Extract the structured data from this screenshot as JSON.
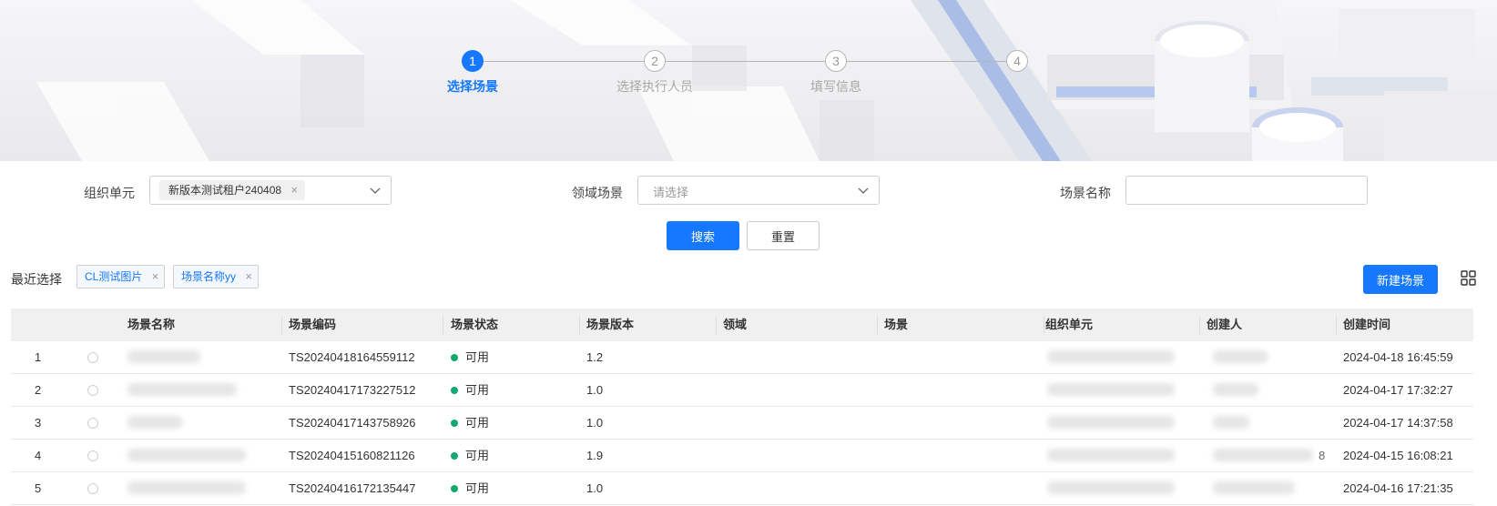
{
  "steps": [
    {
      "num": "1",
      "label": "选择场景",
      "active": true
    },
    {
      "num": "2",
      "label": "选择执行人员",
      "active": false
    },
    {
      "num": "3",
      "label": "填写信息",
      "active": false
    },
    {
      "num": "4",
      "label": "",
      "active": false
    }
  ],
  "filters": {
    "org_label": "组织单元",
    "org_selected_tag": "新版本测试租户240408",
    "domain_label": "领域场景",
    "domain_placeholder": "请选择",
    "scene_name_label": "场景名称",
    "scene_name_value": ""
  },
  "actions": {
    "search": "搜索",
    "reset": "重置",
    "new_scene": "新建场景"
  },
  "recent": {
    "label": "最近选择",
    "tags": [
      "CL测试图片",
      "场景名称yy"
    ]
  },
  "table": {
    "columns": [
      "场景名称",
      "场景编码",
      "场景状态",
      "场景版本",
      "领域",
      "场景",
      "组织单元",
      "创建人",
      "创建时间"
    ],
    "rows": [
      {
        "index": "1",
        "code": "TS20240418164559112",
        "status": "可用",
        "version": "1.2",
        "created": "2024-04-18 16:45:59"
      },
      {
        "index": "2",
        "code": "TS20240417173227512",
        "status": "可用",
        "version": "1.0",
        "created": "2024-04-17 17:32:27"
      },
      {
        "index": "3",
        "code": "TS20240417143758926",
        "status": "可用",
        "version": "1.0",
        "created": "2024-04-17 14:37:58"
      },
      {
        "index": "4",
        "code": "TS20240415160821126",
        "status": "可用",
        "version": "1.9",
        "created": "2024-04-15 16:08:21",
        "creator_fragment": "8"
      },
      {
        "index": "5",
        "code": "TS20240416172135447",
        "status": "可用",
        "version": "1.0",
        "created": "2024-04-16 17:21:35"
      }
    ]
  },
  "colors": {
    "primary": "#1677ff",
    "status_available": "#13a86f"
  },
  "icons": [
    "chevron-down-icon",
    "close-icon",
    "grid-view-icon"
  ]
}
